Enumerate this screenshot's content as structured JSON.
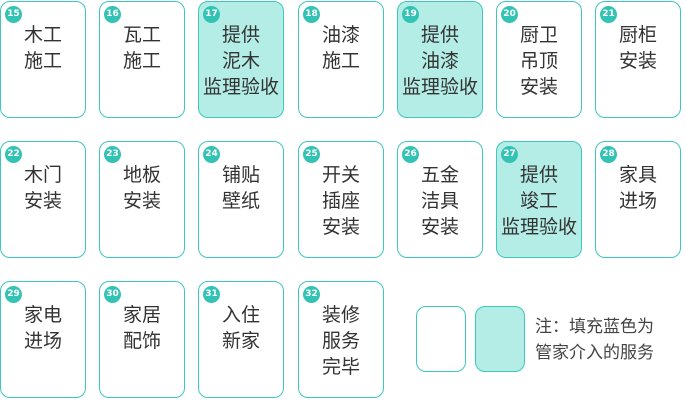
{
  "steps": [
    {
      "number": "15",
      "lines": [
        "木工",
        "施工"
      ],
      "managed": false
    },
    {
      "number": "16",
      "lines": [
        "瓦工",
        "施工"
      ],
      "managed": false
    },
    {
      "number": "17",
      "lines": [
        "提供",
        "泥木",
        "监理验收"
      ],
      "managed": true
    },
    {
      "number": "18",
      "lines": [
        "油漆",
        "施工"
      ],
      "managed": false
    },
    {
      "number": "19",
      "lines": [
        "提供",
        "油漆",
        "监理验收"
      ],
      "managed": true
    },
    {
      "number": "20",
      "lines": [
        "厨卫",
        "吊顶",
        "安装"
      ],
      "managed": false
    },
    {
      "number": "21",
      "lines": [
        "厨柜",
        "安装"
      ],
      "managed": false
    },
    {
      "number": "22",
      "lines": [
        "木门",
        "安装"
      ],
      "managed": false
    },
    {
      "number": "23",
      "lines": [
        "地板",
        "安装"
      ],
      "managed": false
    },
    {
      "number": "24",
      "lines": [
        "铺贴",
        "壁纸"
      ],
      "managed": false
    },
    {
      "number": "25",
      "lines": [
        "开关",
        "插座",
        "安装"
      ],
      "managed": false
    },
    {
      "number": "26",
      "lines": [
        "五金",
        "洁具",
        "安装"
      ],
      "managed": false
    },
    {
      "number": "27",
      "lines": [
        "提供",
        "竣工",
        "监理验收"
      ],
      "managed": true
    },
    {
      "number": "28",
      "lines": [
        "家具",
        "进场"
      ],
      "managed": false
    },
    {
      "number": "29",
      "lines": [
        "家电",
        "进场"
      ],
      "managed": false
    },
    {
      "number": "30",
      "lines": [
        "家居",
        "配饰"
      ],
      "managed": false
    },
    {
      "number": "31",
      "lines": [
        "入住",
        "新家"
      ],
      "managed": false
    },
    {
      "number": "32",
      "lines": [
        "装修",
        "服务",
        "完毕"
      ],
      "managed": false
    }
  ],
  "legend": {
    "lines": [
      "注：填充蓝色为",
      "管家介入的服务"
    ]
  },
  "colors": {
    "border": "#3ec8bd",
    "badge": "#33c3b5",
    "managed_fill": "#b3ede6",
    "text": "#333333"
  }
}
